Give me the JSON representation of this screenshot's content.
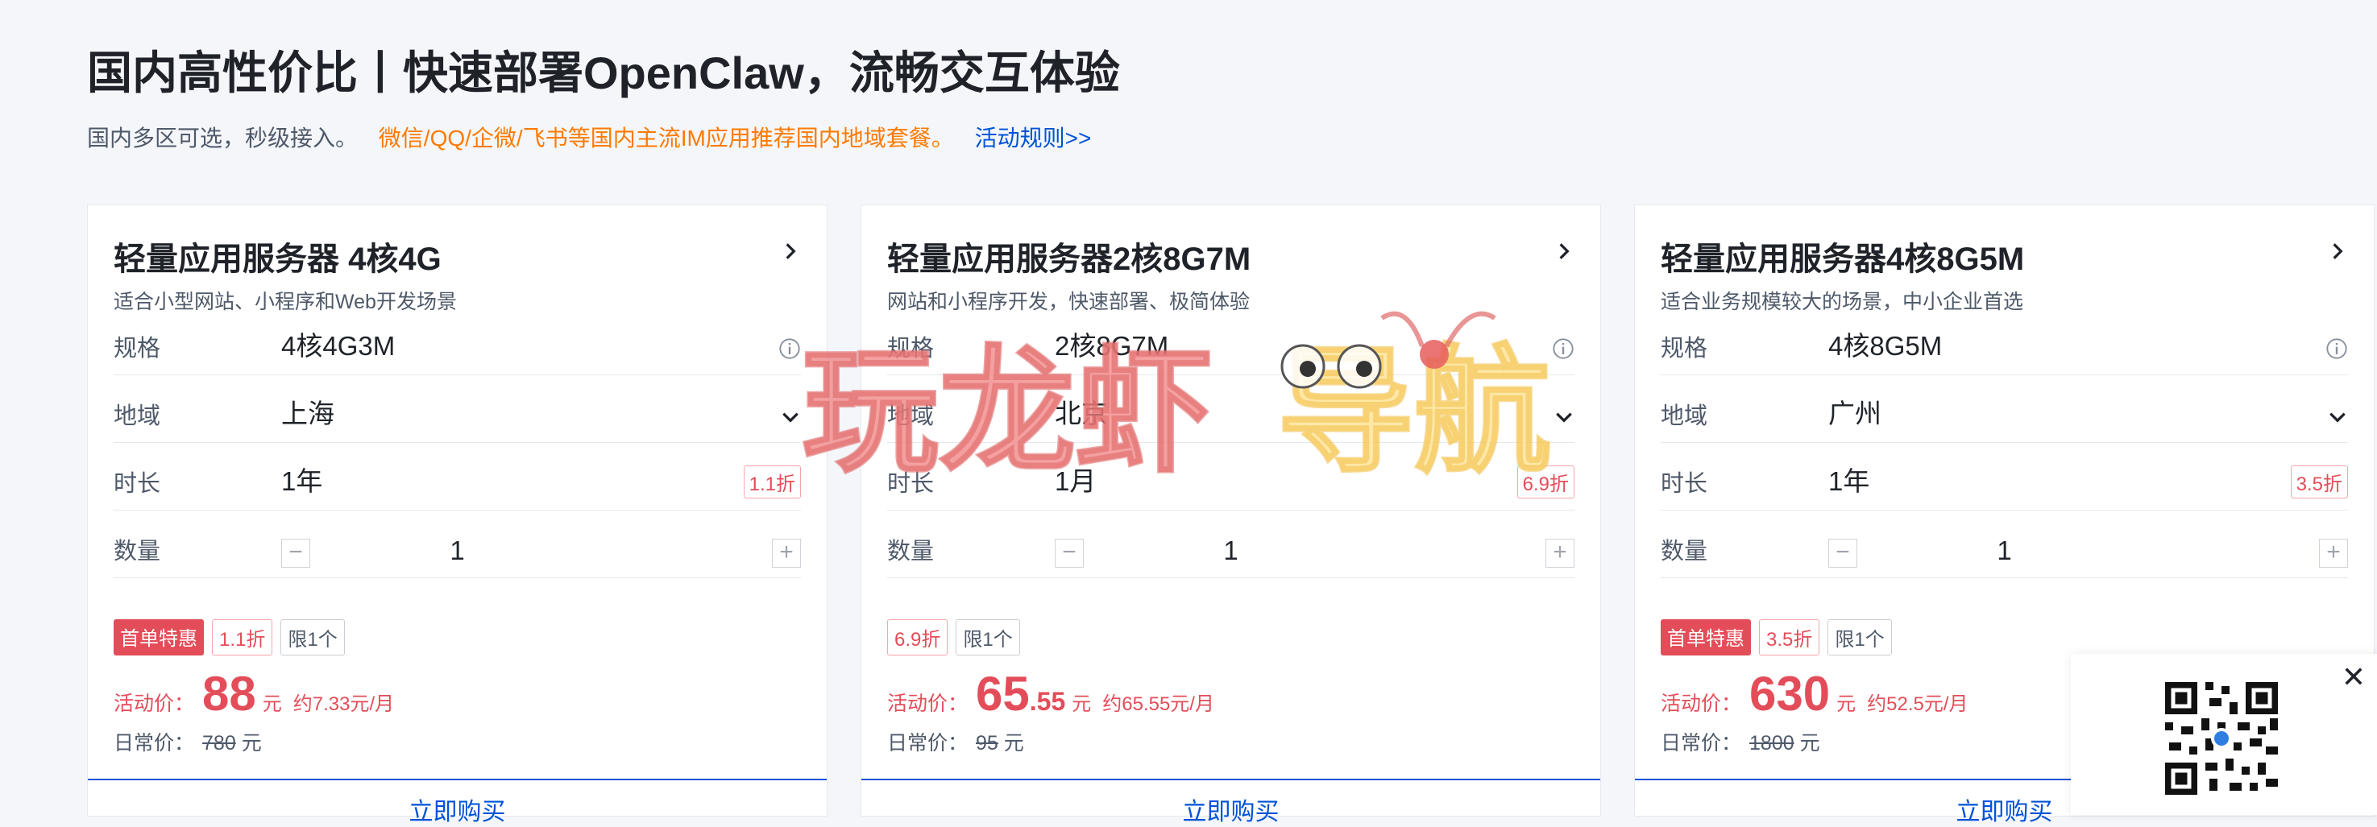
{
  "header": {
    "title": "国内高性价比丨快速部署OpenClaw，流畅交互体验",
    "sub_plain": "国内多区可选，秒级接入。",
    "sub_promo": "微信/QQ/企微/飞书等国内主流IM应用推荐国内地域套餐。",
    "sub_rules": "活动规则>>"
  },
  "labels": {
    "spec": "规格",
    "region": "地域",
    "duration": "时长",
    "quantity": "数量",
    "activity_price": "活动价：",
    "daily_price": "日常价：",
    "yuan": "元"
  },
  "cards": [
    {
      "title": "轻量应用服务器 4核4G",
      "desc": "适合小型网站、小程序和Web开发场景",
      "spec": "4核4G3M",
      "region": "上海",
      "duration": "1年",
      "duration_discount": "1.1折",
      "quantity": "1",
      "badge_first": "首单特惠",
      "badge_discount": "1.1折",
      "badge_limit": "限1个",
      "price_int": "88",
      "price_dec": "",
      "monthly": "约7.33元/月",
      "daily_value": "780",
      "buy": "立即购买"
    },
    {
      "title": "轻量应用服务器2核8G7M",
      "desc": "网站和小程序开发，快速部署、极简体验",
      "spec": "2核8G7M",
      "region": "北京",
      "duration": "1月",
      "duration_discount": "6.9折",
      "quantity": "1",
      "badge_first": "",
      "badge_discount": "6.9折",
      "badge_limit": "限1个",
      "price_int": "65",
      "price_dec": ".55",
      "monthly": "约65.55元/月",
      "daily_value": "95",
      "buy": "立即购买"
    },
    {
      "title": "轻量应用服务器4核8G5M",
      "desc": "适合业务规模较大的场景，中小企业首选",
      "spec": "4核8G5M",
      "region": "广州",
      "duration": "1年",
      "duration_discount": "3.5折",
      "quantity": "1",
      "badge_first": "首单特惠",
      "badge_discount": "3.5折",
      "badge_limit": "限1个",
      "price_int": "630",
      "price_dec": "",
      "monthly": "约52.5元/月",
      "daily_value": "1800",
      "buy": "立即购买"
    }
  ],
  "watermark": {
    "part1": "玩龙虾",
    "part2": "导航"
  },
  "qr_panel": {
    "close": "✕"
  },
  "colors": {
    "accent": "#0052d9",
    "price": "#e34d59",
    "promo": "#ff7a00"
  },
  "icons": [
    "chevron-right-icon",
    "info-icon",
    "chevron-down-icon",
    "minus-icon",
    "plus-icon",
    "close-icon",
    "qr-code-icon",
    "lobster-mascot-icon"
  ]
}
